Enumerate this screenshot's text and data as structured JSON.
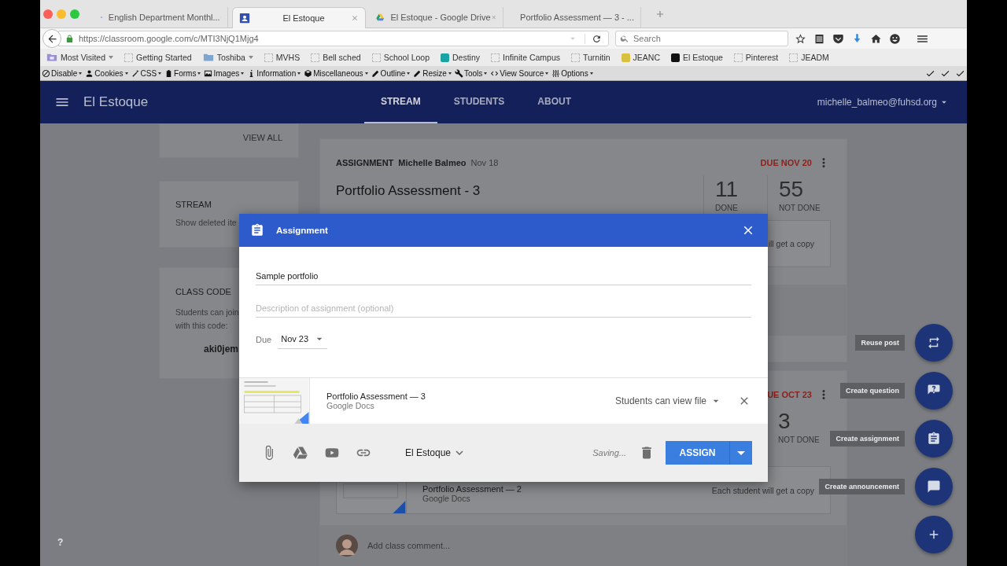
{
  "browser": {
    "tabs": [
      {
        "title": "English Department Monthl...",
        "kind": "doc",
        "selected": false
      },
      {
        "title": "El Estoque",
        "kind": "classroom",
        "selected": true
      },
      {
        "title": "El Estoque - Google Drive",
        "kind": "drive",
        "selected": false
      },
      {
        "title": "Portfolio Assessment — 3 - ...",
        "kind": "doc",
        "selected": false
      }
    ],
    "url": "https://classroom.google.com/c/MTI3NjQ1Mjg4",
    "search_placeholder": "Search",
    "bookmarks": [
      {
        "label": "Most Visited",
        "kind": "smart-folder",
        "dropdown": true
      },
      {
        "label": "Getting Started",
        "kind": "page",
        "dropdown": false
      },
      {
        "label": "Toshiba",
        "kind": "folder",
        "dropdown": true
      },
      {
        "label": "MVHS",
        "kind": "page",
        "dropdown": false
      },
      {
        "label": "Bell sched",
        "kind": "page",
        "dropdown": false
      },
      {
        "label": "School Loop",
        "kind": "page",
        "dropdown": false
      },
      {
        "label": "Destiny",
        "kind": "site",
        "color": "#1aa3a3",
        "dropdown": false
      },
      {
        "label": "Infinite Campus",
        "kind": "page",
        "dropdown": false
      },
      {
        "label": "Turnitin",
        "kind": "page",
        "dropdown": false
      },
      {
        "label": "JEANC",
        "kind": "site",
        "color": "#d8c040",
        "dropdown": false
      },
      {
        "label": "El Estoque",
        "kind": "site",
        "color": "#111111",
        "dropdown": false
      },
      {
        "label": "Pinterest",
        "kind": "page",
        "dropdown": false
      },
      {
        "label": "JEADM",
        "kind": "page",
        "dropdown": false
      }
    ],
    "devtools": [
      {
        "label": "Disable",
        "kind": "block"
      },
      {
        "label": "Cookies",
        "kind": "person"
      },
      {
        "label": "CSS",
        "kind": "wand"
      },
      {
        "label": "Forms",
        "kind": "clipboard"
      },
      {
        "label": "Images",
        "kind": "image"
      },
      {
        "label": "Information",
        "kind": "info"
      },
      {
        "label": "Miscellaneous",
        "kind": "cube"
      },
      {
        "label": "Outline",
        "kind": "pencil"
      },
      {
        "label": "Resize",
        "kind": "pencil"
      },
      {
        "label": "Tools",
        "kind": "wrench"
      },
      {
        "label": "View Source",
        "kind": "code"
      },
      {
        "label": "Options",
        "kind": "sliders"
      }
    ]
  },
  "app": {
    "title": "El Estoque",
    "tabs": [
      {
        "label": "STREAM",
        "selected": true
      },
      {
        "label": "STUDENTS",
        "selected": false
      },
      {
        "label": "ABOUT",
        "selected": false
      }
    ],
    "account": "michelle_balmeo@fuhsd.org"
  },
  "sidebar": {
    "view_all": "VIEW ALL",
    "stream_heading": "STREAM",
    "stream_link": "Show deleted ite",
    "class_code_heading": "CLASS CODE",
    "class_code_lines": [
      "Students can join",
      "with this code:"
    ],
    "class_code": "aki0jem"
  },
  "posts": [
    {
      "type": "ASSIGNMENT",
      "author": "Michelle Balmeo",
      "date": "Nov 18",
      "title": "Portfolio Assessment - 3",
      "due": "DUE NOV 20",
      "stats": [
        {
          "count": "11",
          "label": "DONE"
        },
        {
          "count": "55",
          "label": "NOT DONE"
        }
      ],
      "attachment_note": "ill get a copy"
    },
    {
      "due": "UE OCT 23",
      "stats": [
        {
          "count": "3",
          "label": "NOT DONE"
        }
      ],
      "attachment": {
        "title": "Portfolio Assessment — 2",
        "source": "Google Docs",
        "note": "Each student will get a copy"
      },
      "comment_placeholder": "Add class comment..."
    }
  ],
  "dialog": {
    "title": "Assignment",
    "title_value": "Sample portfolio",
    "description_placeholder": "Description of assignment (optional)",
    "due_label": "Due",
    "due_value": "Nov 23",
    "attachment": {
      "title": "Portfolio Assessment — 3",
      "source": "Google Docs",
      "permission": "Students can view file"
    },
    "class_name": "El Estoque",
    "status": "Saving...",
    "assign": "ASSIGN"
  },
  "fab": [
    {
      "label": "Reuse post",
      "kind": "repeat"
    },
    {
      "label": "Create question",
      "kind": "question"
    },
    {
      "label": "Create assignment",
      "kind": "assignment"
    },
    {
      "label": "Create announcement",
      "kind": "announcement"
    },
    {
      "kind": "plus"
    }
  ],
  "help": "?"
}
